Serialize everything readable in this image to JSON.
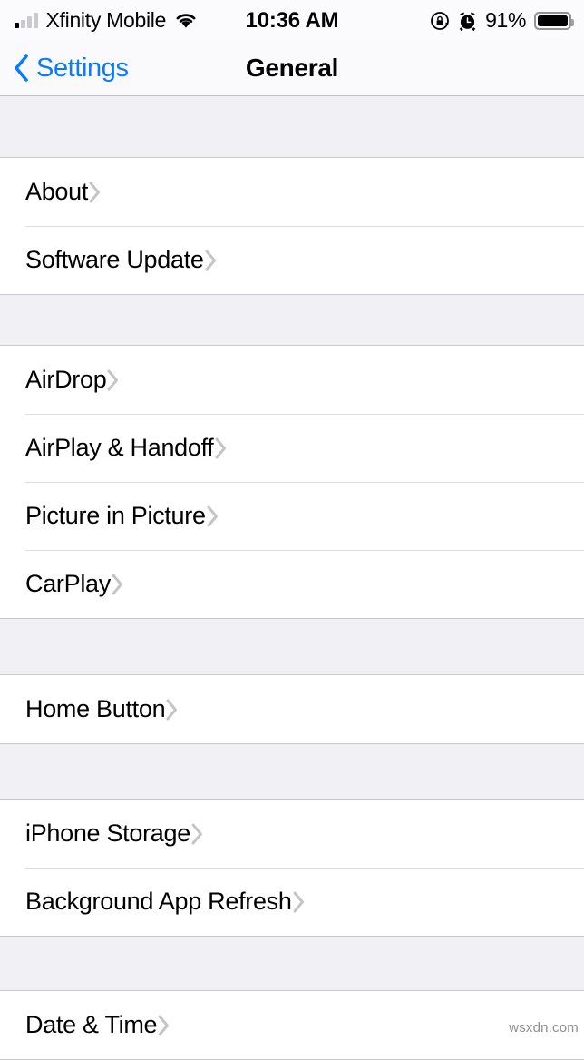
{
  "status_bar": {
    "carrier": "Xfinity Mobile",
    "signal_bars_filled": 1,
    "signal_bars_total": 4,
    "wifi_icon": "wifi-icon",
    "time": "10:36 AM",
    "rotation_lock_icon": "rotation-lock-icon",
    "alarm_icon": "alarm-clock-icon",
    "battery_percent": "91%",
    "battery_level": 91,
    "battery_icon": "battery-icon"
  },
  "nav_bar": {
    "back_label": "Settings",
    "back_icon": "chevron-left-icon",
    "title": "General"
  },
  "colors": {
    "accent_blue": "#0A7AFF",
    "group_background": "#F1F1F5",
    "row_background": "#FFFFFF",
    "separator": "#DDDDDF",
    "chevron": "#C4C4C6",
    "label_text": "#000000"
  },
  "sections": [
    {
      "rows": [
        {
          "label": "About",
          "chevron": "chevron-right-icon"
        },
        {
          "label": "Software Update",
          "chevron": "chevron-right-icon"
        }
      ]
    },
    {
      "rows": [
        {
          "label": "AirDrop",
          "chevron": "chevron-right-icon"
        },
        {
          "label": "AirPlay & Handoff",
          "chevron": "chevron-right-icon"
        },
        {
          "label": "Picture in Picture",
          "chevron": "chevron-right-icon"
        },
        {
          "label": "CarPlay",
          "chevron": "chevron-right-icon"
        }
      ]
    },
    {
      "rows": [
        {
          "label": "Home Button",
          "chevron": "chevron-right-icon"
        }
      ]
    },
    {
      "rows": [
        {
          "label": "iPhone Storage",
          "chevron": "chevron-right-icon"
        },
        {
          "label": "Background App Refresh",
          "chevron": "chevron-right-icon"
        }
      ]
    },
    {
      "rows": [
        {
          "label": "Date & Time",
          "chevron": "chevron-right-icon"
        }
      ]
    }
  ],
  "watermark": {
    "text": "wsxdn.com"
  }
}
